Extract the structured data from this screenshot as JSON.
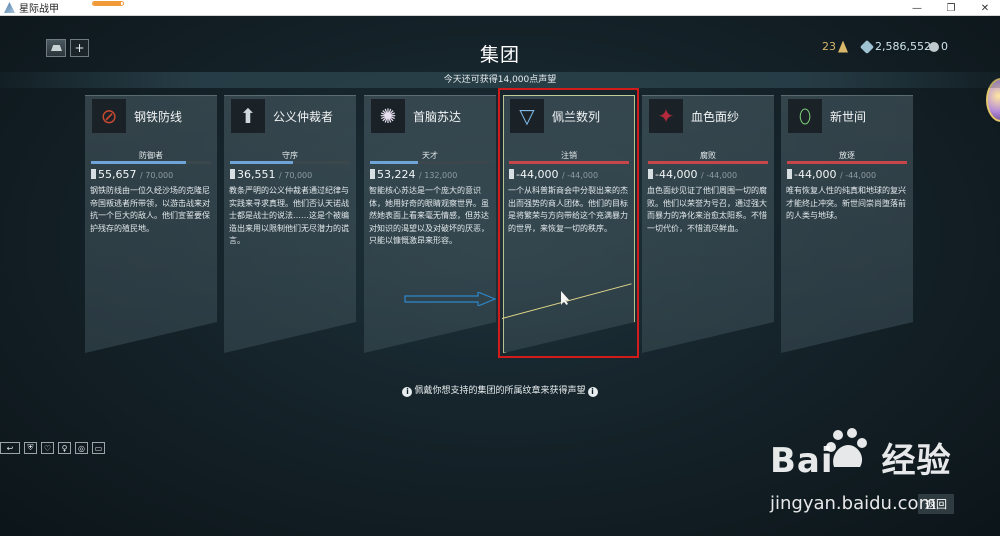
{
  "window": {
    "title": "星际战甲",
    "download_progress": 0.92,
    "controls": {
      "minimize": "—",
      "maximize": "❐",
      "close": "✕"
    }
  },
  "topbar": {
    "add_label": "+",
    "page_title": "集团",
    "mastery_rank": "23",
    "credits": "2,586,552",
    "platinum": "0"
  },
  "standing_banner": "今天还可获得14,000点声望",
  "syndicates": [
    {
      "name": "钢铁防线",
      "rank": "防御者",
      "standing": "55,657",
      "max": "/ 70,000",
      "progress": 0.795,
      "bar_color": "#6fa4d9",
      "emblem_color": "#c8492f",
      "emblem_glyph": "⊘",
      "desc": "钢铁防线由一位久经沙场的克隆尼帝国叛逃者所带领，以游击战来对抗一个巨大的敌人。他们宣誓要保护残存的殖民地。"
    },
    {
      "name": "公义仲裁者",
      "rank": "守序",
      "standing": "36,551",
      "max": "/ 70,000",
      "progress": 0.522,
      "bar_color": "#6fa4d9",
      "emblem_color": "#cfd8dc",
      "emblem_glyph": "⬆",
      "desc": "教条严明的公义仲裁者通过纪律与实践来寻求真理。他们否认天诺战士都是战士的说法……这是个被编造出来用以限制他们无尽潜力的谎言。"
    },
    {
      "name": "首脑苏达",
      "rank": "天才",
      "standing": "53,224",
      "max": "/ 132,000",
      "progress": 0.403,
      "bar_color": "#6fa4d9",
      "emblem_color": "#e7e0f0",
      "emblem_glyph": "✺",
      "desc": "智能核心苏达是一个庞大的意识体，她用好奇的眼睛观察世界。虽然她表面上看来毫无情感，但苏达对知识的渴望以及对破坏的厌恶，只能以慷慨激昂来形容。"
    },
    {
      "name": "佩兰数列",
      "rank": "注销",
      "standing": "-44,000",
      "max": "/ -44,000",
      "progress": 1,
      "bar_color": "#c8454a",
      "emblem_color": "#7fb8e6",
      "emblem_glyph": "▽",
      "desc": "一个从科普斯商会中分裂出来的杰出而强势的商人团体。他们的目标是将繁荣与方向带给这个充满暴力的世界，来恢复一切的秩序。"
    },
    {
      "name": "血色面纱",
      "rank": "腐败",
      "standing": "-44,000",
      "max": "/ -44,000",
      "progress": 1,
      "bar_color": "#c8454a",
      "emblem_color": "#b32a3c",
      "emblem_glyph": "✦",
      "desc": "血色面纱见证了他们周围一切的腐败。他们以荣誉为号召，通过强大而暴力的净化来治愈太阳系。不惜一切代价，不惜流尽鲜血。"
    },
    {
      "name": "新世间",
      "rank": "放逐",
      "standing": "-44,000",
      "max": "/ -44,000",
      "progress": 1,
      "bar_color": "#c8454a",
      "emblem_color": "#7dd37a",
      "emblem_glyph": "⬯",
      "desc": "唯有恢复人性的纯真和地球的复兴才能终止冲突。新世间崇尚堕落前的人类与地球。"
    }
  ],
  "footer_hint": "佩戴你想支持的集团的所属纹章来获得声望",
  "info_glyph": "i",
  "bottom_bar": [
    "↩",
    "⛨",
    "♡",
    "♀",
    "◎",
    "▭"
  ],
  "back_label": "返回",
  "watermark": {
    "logo": "Bai",
    "logo_tail": "经验",
    "url": "jingyan.baidu.com"
  }
}
